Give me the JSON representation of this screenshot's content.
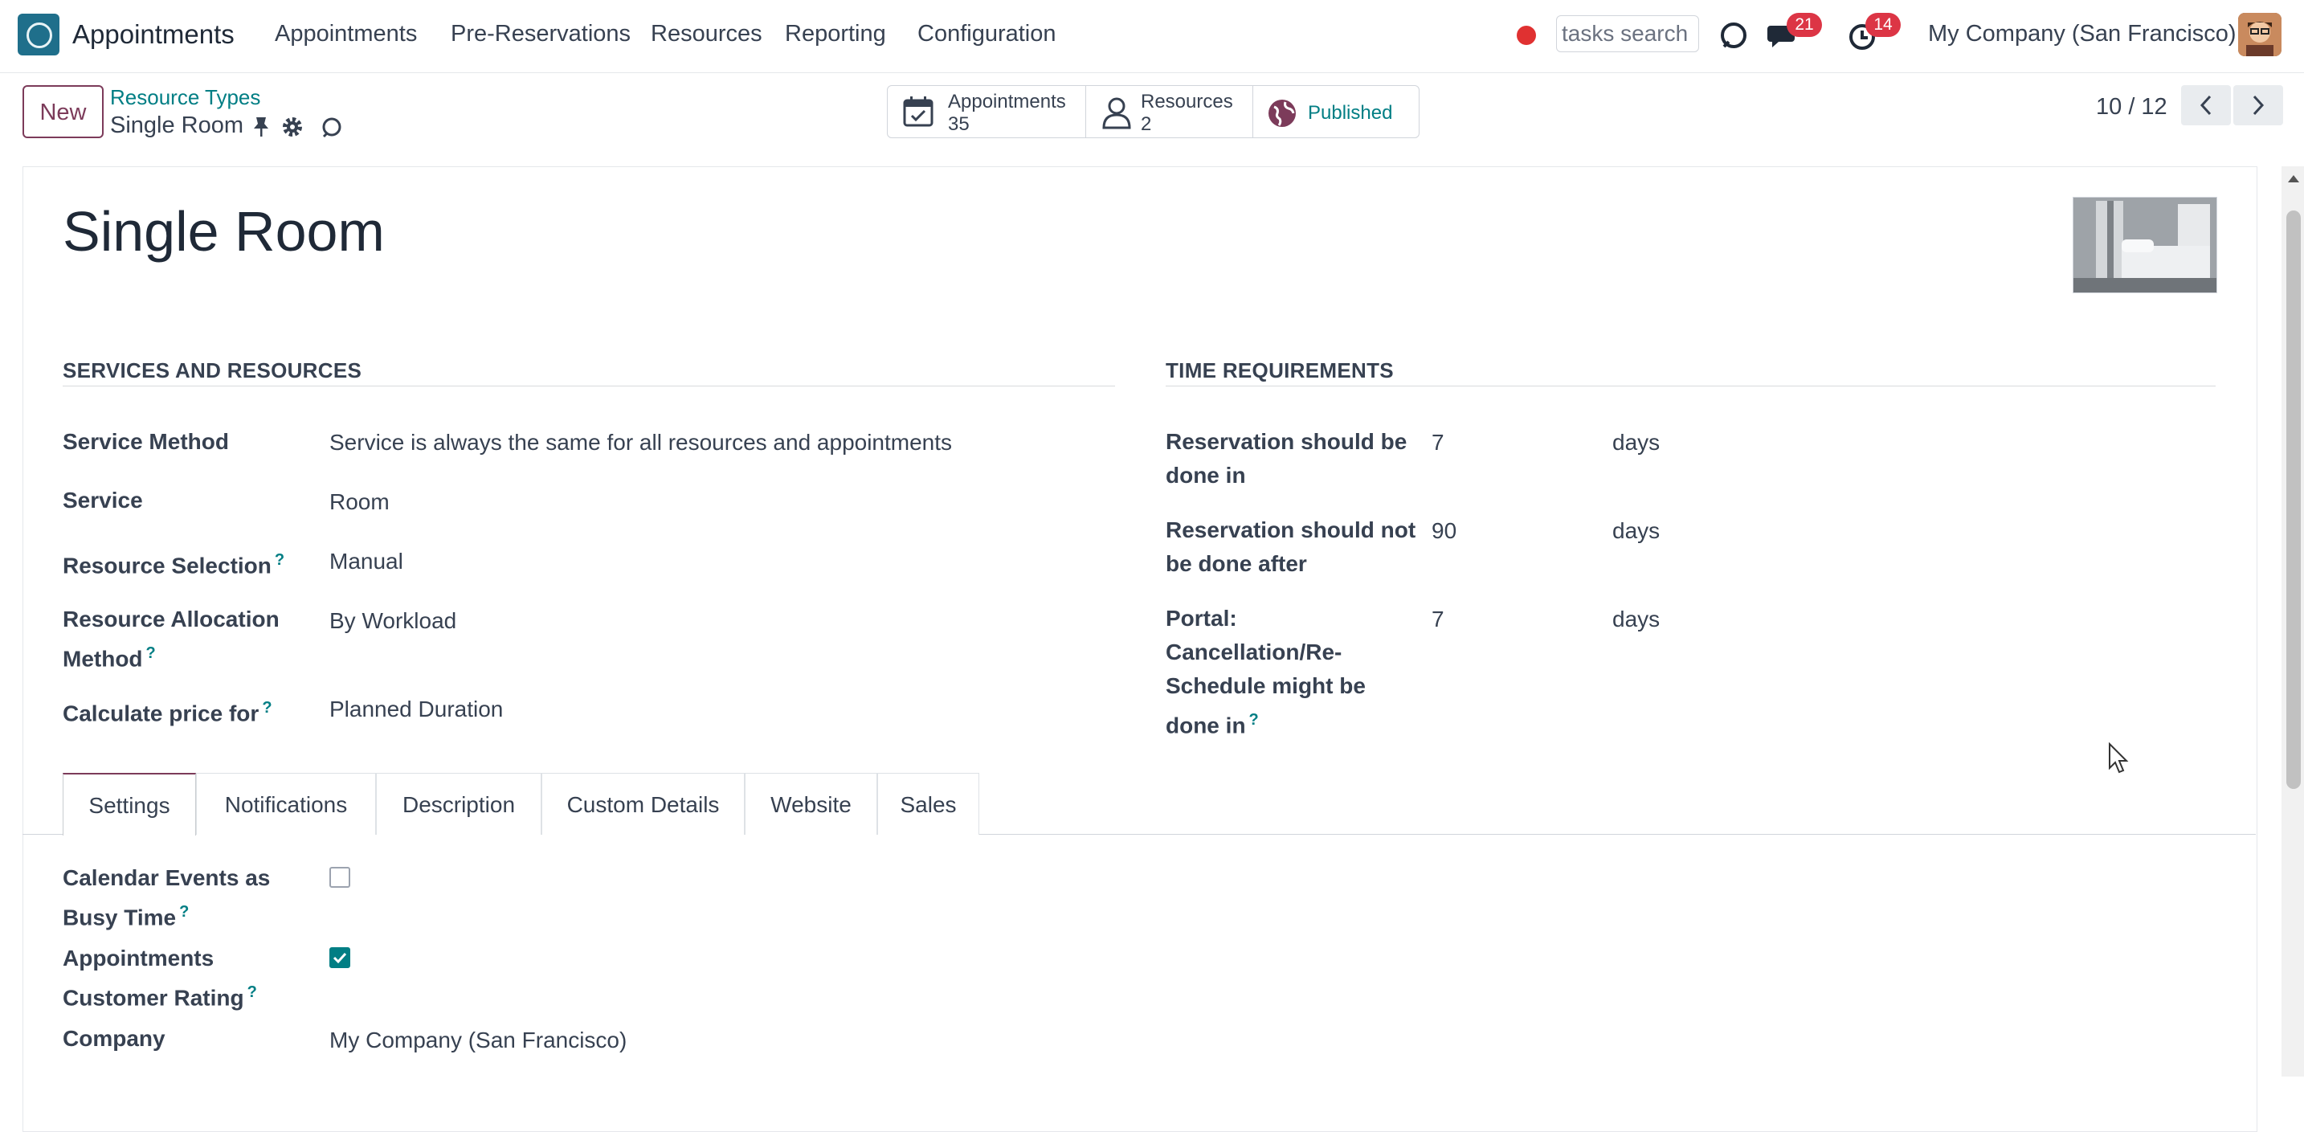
{
  "navbar": {
    "app_name": "Appointments",
    "menus": [
      "Appointments",
      "Pre-Reservations",
      "Resources",
      "Reporting",
      "Configuration"
    ],
    "search_placeholder": "tasks search",
    "messages_count": "21",
    "activities_count": "14",
    "company": "My Company (San Francisco)"
  },
  "control_panel": {
    "new_label": "New",
    "breadcrumb_parent": "Resource Types",
    "breadcrumb_current": "Single Room",
    "smart_buttons": {
      "appointments": {
        "label": "Appointments",
        "value": "35"
      },
      "resources": {
        "label": "Resources",
        "value": "2"
      },
      "published": {
        "label": "Published"
      }
    },
    "pager": "10 / 12"
  },
  "form": {
    "title": "Single Room",
    "services_section": {
      "heading": "SERVICES AND RESOURCES",
      "service_method": {
        "label": "Service Method",
        "value": "Service is always the same for all resources and appointments"
      },
      "service": {
        "label": "Service",
        "value": "Room"
      },
      "resource_selection": {
        "label": "Resource Selection",
        "value": "Manual"
      },
      "resource_allocation": {
        "label_line1": "Resource Allocation",
        "label_line2": "Method",
        "value": "By Workload"
      },
      "calculate_price": {
        "label": "Calculate price for",
        "value": "Planned Duration"
      }
    },
    "time_section": {
      "heading": "TIME REQUIREMENTS",
      "reservation_in": {
        "label_line1": "Reservation should be",
        "label_line2": "done in",
        "value": "7",
        "unit": "days"
      },
      "reservation_not_after": {
        "label_line1": "Reservation should not",
        "label_line2": "be done after",
        "value": "90",
        "unit": "days"
      },
      "portal_cancel": {
        "label_line1": "Portal:",
        "label_line2": "Cancellation/Re-",
        "label_line3": "Schedule might be",
        "label_line4": "done in",
        "value": "7",
        "unit": "days"
      }
    },
    "tabs": [
      "Settings",
      "Notifications",
      "Description",
      "Custom Details",
      "Website",
      "Sales"
    ],
    "settings": {
      "calendar_busy": {
        "label_line1": "Calendar Events as",
        "label_line2": "Busy Time",
        "checked": false
      },
      "customer_rating": {
        "label_line1": "Appointments",
        "label_line2": "Customer Rating",
        "checked": true
      },
      "company": {
        "label": "Company",
        "value": "My Company (San Francisco)"
      }
    }
  },
  "colors": {
    "brand": "#7c3b5a",
    "accent": "#017e84",
    "badge": "#dc3545"
  },
  "help_marker": "?"
}
